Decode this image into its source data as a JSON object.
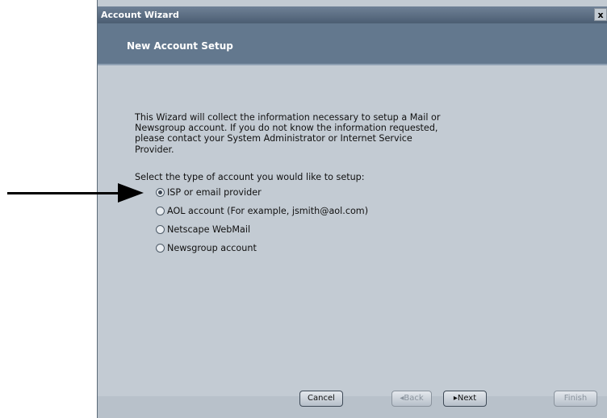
{
  "window": {
    "title": "Account Wizard",
    "close_label": "x"
  },
  "header": {
    "title": "New Account Setup"
  },
  "content": {
    "intro_lines": [
      "This Wizard will collect the information necessary to setup a Mail or",
      "Newsgroup account. If you do not know the information requested,",
      "please contact your System Administrator or Internet Service",
      "Provider."
    ],
    "prompt": "Select the type of account you would like to setup:",
    "options": [
      {
        "label": "ISP or email provider",
        "selected": true
      },
      {
        "label": "AOL account (For example, jsmith@aol.com)",
        "selected": false
      },
      {
        "label": "Netscape WebMail",
        "selected": false
      },
      {
        "label": "Newsgroup account",
        "selected": false
      }
    ]
  },
  "buttons": {
    "cancel": "Cancel",
    "back": "◂Back",
    "next": "▸Next",
    "finish": "Finish"
  },
  "annotation": {
    "icon": "arrow-right-icon"
  }
}
